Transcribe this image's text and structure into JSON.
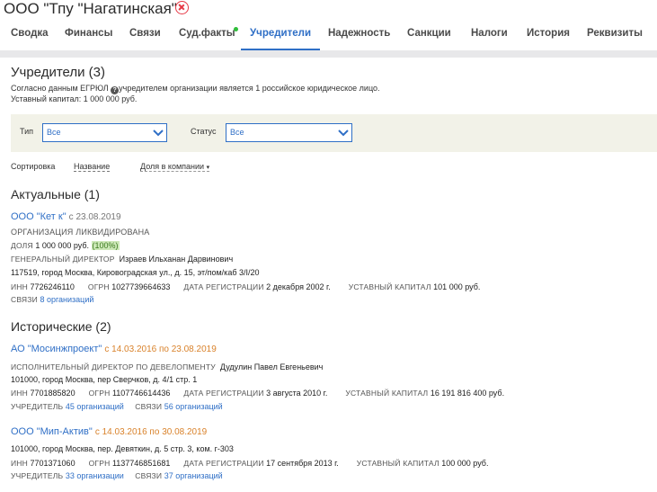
{
  "header": {
    "title": "ООО \"Тпу \"Нагатинская\""
  },
  "tabs": [
    {
      "label": "Сводка"
    },
    {
      "label": "Финансы"
    },
    {
      "label": "Связи"
    },
    {
      "label": "Суд.факты"
    },
    {
      "label": "Учредители"
    },
    {
      "label": "Надежность"
    },
    {
      "label": "Санкции"
    },
    {
      "label": "Налоги"
    },
    {
      "label": "История"
    },
    {
      "label": "Реквизиты"
    }
  ],
  "founders": {
    "title": "Учредители (3)",
    "note_prefix": "Согласно данным ЕГРЮЛ",
    "note_suffix": "учредителем организации является 1 российское юридическое лицо.",
    "capital": "Уставный капитал: 1 000 000 руб."
  },
  "filters": {
    "type_label": "Тип",
    "type_value": "Все",
    "status_label": "Статус",
    "status_value": "Все"
  },
  "sort": {
    "label": "Сортировка",
    "by_name": "Название",
    "by_share": "Доля в компании",
    "arrow": "▾"
  },
  "current": {
    "title": "Актуальные (1)",
    "org": {
      "name": "ООО \"Кет к\"",
      "since": "с 23.08.2019",
      "status": "ОРГАНИЗАЦИЯ ЛИКВИДИРОВАНА",
      "share_label": "ДОЛЯ",
      "share_value": "1 000 000 руб.",
      "share_pct": "(100%)",
      "director_label": "ГЕНЕРАЛЬНЫЙ ДИРЕКТОР",
      "director_name": "Израев Ильханан Дарвинович",
      "address": "117519, город Москва, Кировоградская ул., д. 15, эт/пом/каб 3/I/20",
      "inn_label": "ИНН",
      "inn": "7726246110",
      "ogrn_label": "ОГРН",
      "ogrn": "1027739664633",
      "reg_label": "ДАТА РЕГИСТРАЦИИ",
      "reg": "2 декабря 2002 г.",
      "cap_label": "УСТАВНЫЙ КАПИТАЛ",
      "cap": "101 000 руб.",
      "links_label": "СВЯЗИ",
      "links": "8 организаций"
    }
  },
  "historic": {
    "title": "Исторические (2)",
    "orgs": [
      {
        "name": "АО \"Мосинжпроект\"",
        "period": "с 14.03.2016 по 23.08.2019",
        "director_label": "ИСПОЛНИТЕЛЬНЫЙ ДИРЕКТОР ПО ДЕВЕЛОПМЕНТУ",
        "director_name": "Дудулин Павел Евгеньевич",
        "address": "101000, город Москва, пер Сверчков, д. 4/1 стр. 1",
        "inn_label": "ИНН",
        "inn": "7701885820",
        "ogrn_label": "ОГРН",
        "ogrn": "1107746614436",
        "reg_label": "ДАТА РЕГИСТРАЦИИ",
        "reg": "3 августа 2010 г.",
        "cap_label": "УСТАВНЫЙ КАПИТАЛ",
        "cap": "16 191 816 400 руб.",
        "founder_label": "УЧРЕДИТЕЛЬ",
        "founder": "45 организаций",
        "links_label": "СВЯЗИ",
        "links": "56 организаций"
      },
      {
        "name": "ООО \"Мип-Актив\"",
        "period": "с 14.03.2016 по 30.08.2019",
        "address": "101000, город Москва, пер. Девяткин, д. 5 стр. 3, ком. г-303",
        "inn_label": "ИНН",
        "inn": "7701371060",
        "ogrn_label": "ОГРН",
        "ogrn": "1137746851681",
        "reg_label": "ДАТА РЕГИСТРАЦИИ",
        "reg": "17 сентября 2013 г.",
        "cap_label": "УСТАВНЫЙ КАПИТАЛ",
        "cap": "100 000 руб.",
        "founder_label": "УЧРЕДИТЕЛЬ",
        "founder": "33 организации",
        "links_label": "СВЯЗИ",
        "links": "37 организаций"
      }
    ]
  },
  "colors": {
    "accent": "#2f6fc6",
    "orange": "#d9822b",
    "danger": "#e63946",
    "success_dot": "#2fbe3a"
  }
}
